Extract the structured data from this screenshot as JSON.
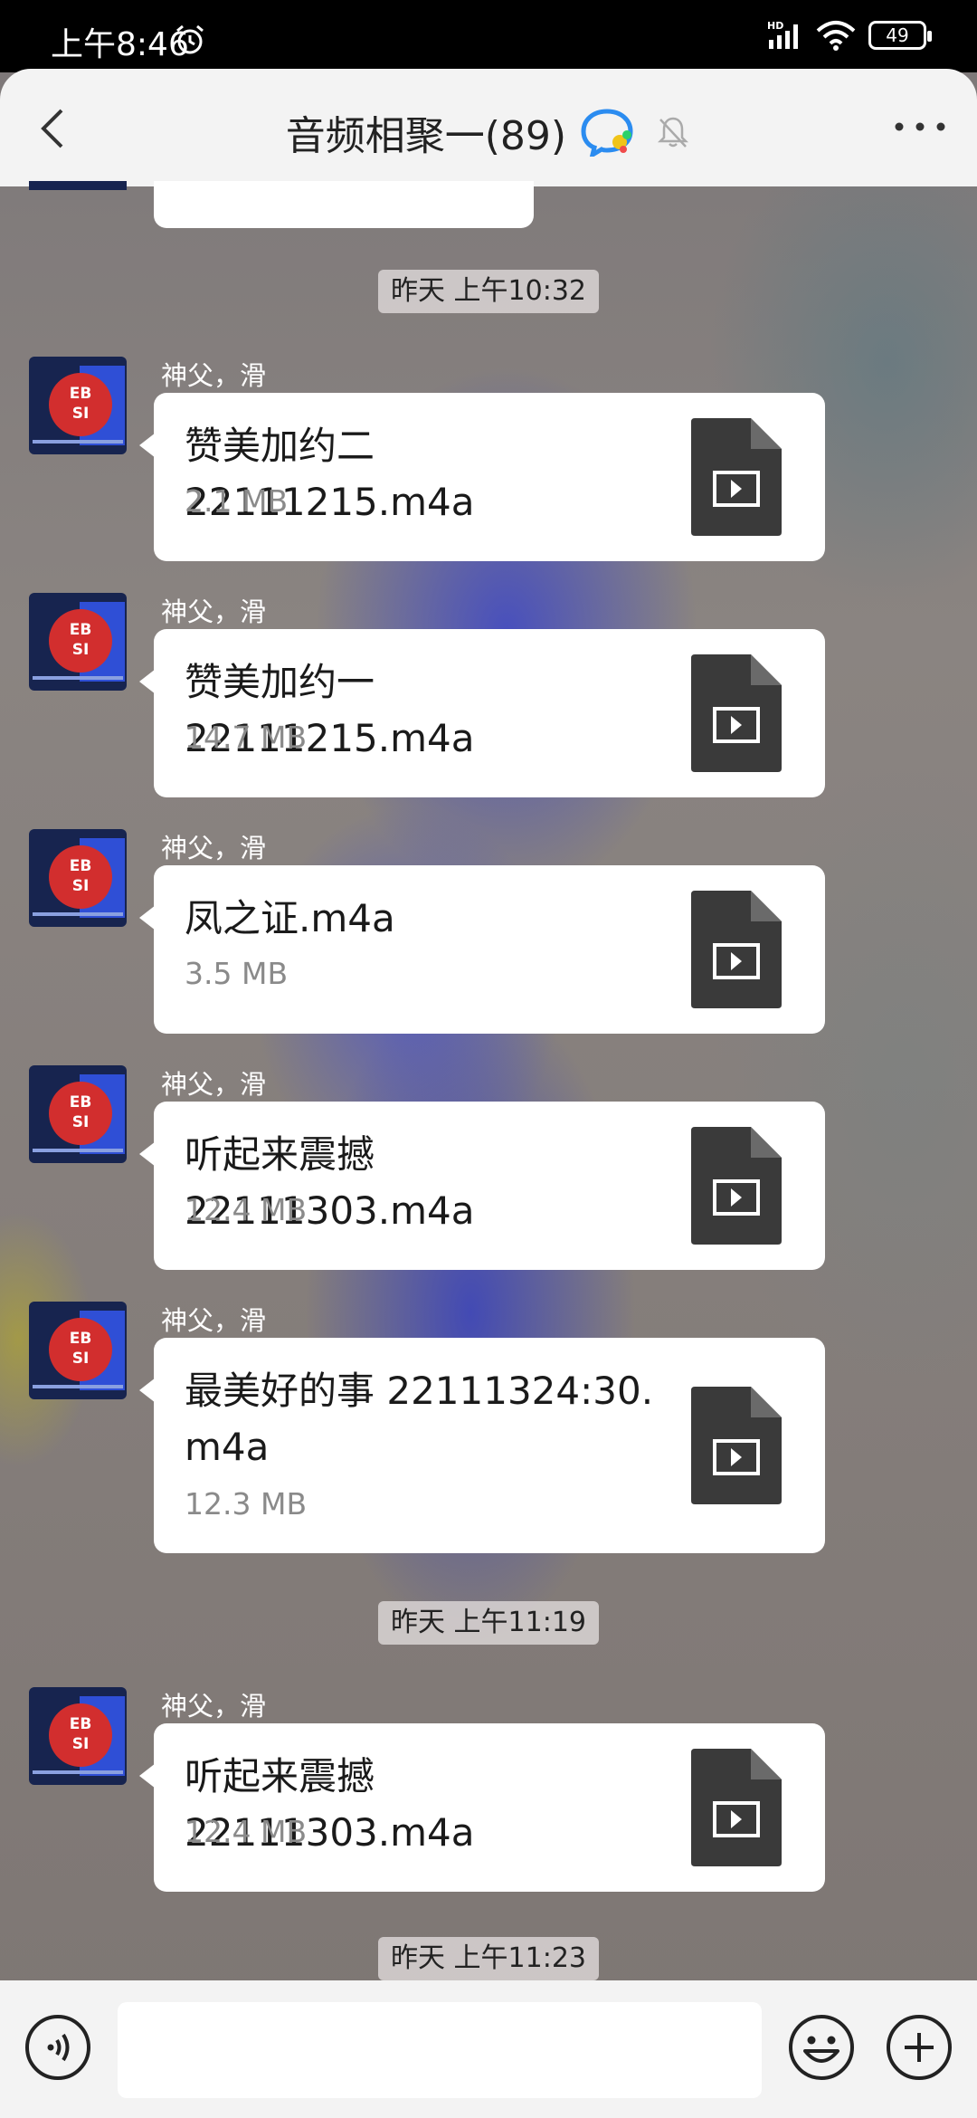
{
  "status_bar": {
    "time": "上午8:46",
    "network": "HD",
    "battery": "49"
  },
  "header": {
    "title": "音频相聚一(89)"
  },
  "timestamps": [
    "昨天 上午10:32",
    "昨天 上午11:19",
    "昨天 上午11:23"
  ],
  "messages": [
    {
      "sender": "神父，滑",
      "file_name": "赞美加约二 22111215.m4a",
      "file_size": "2.1 MB"
    },
    {
      "sender": "神父，滑",
      "file_name": "赞美加约一 22111215.m4a",
      "file_size": "14.7 MB"
    },
    {
      "sender": "神父，滑",
      "file_name": "凤之证.m4a",
      "file_size": "3.5 MB"
    },
    {
      "sender": "神父，滑",
      "file_name": "听起来震撼 22111303.m4a",
      "file_size": "12.4 MB"
    },
    {
      "sender": "神父，滑",
      "file_name": "最美好的事 22111324:30.m4a",
      "file_size": "12.3 MB"
    },
    {
      "sender": "神父，滑",
      "file_name": "听起来震撼 22111303.m4a",
      "file_size": "12.4 MB"
    }
  ],
  "avatar_text": {
    "line1": "EB",
    "line2": "SI"
  },
  "icons": {
    "back": "chevron-left-icon",
    "qq_group": "qq-chat-icon",
    "mute": "bell-off-icon",
    "more": "more-dots-icon",
    "file": "video-file-icon",
    "voice": "voice-icon",
    "emoji": "emoji-icon",
    "plus": "plus-icon"
  },
  "colors": {
    "header_bg": "#f3f3f3",
    "bubble_bg": "#ffffff",
    "file_icon": "#3a3a3a",
    "sender_text": "#ffffff"
  }
}
